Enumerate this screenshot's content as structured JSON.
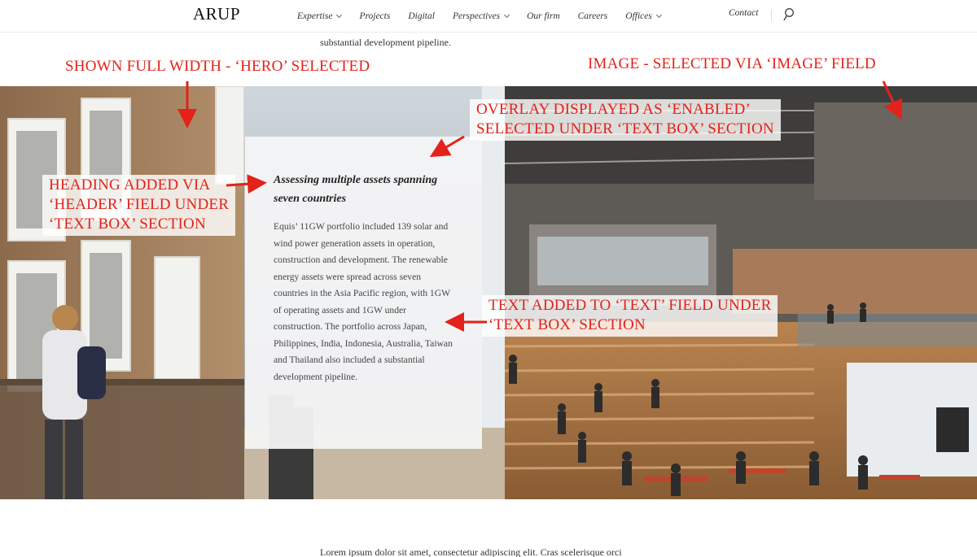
{
  "brand": {
    "logo_text": "ARUP"
  },
  "nav": {
    "items": [
      {
        "label": "Expertise",
        "has_dropdown": true
      },
      {
        "label": "Projects",
        "has_dropdown": false
      },
      {
        "label": "Digital",
        "has_dropdown": false
      },
      {
        "label": "Perspectives",
        "has_dropdown": true
      },
      {
        "label": "Our firm",
        "has_dropdown": false
      },
      {
        "label": "Careers",
        "has_dropdown": false
      },
      {
        "label": "Offices",
        "has_dropdown": true
      }
    ],
    "contact_label": "Contact",
    "search_icon": "search-icon"
  },
  "page": {
    "intro_line": "substantial development pipeline.",
    "lorem_line": "Lorem ipsum dolor sit amet, consectetur adipiscing elit. Cras scelerisque orci"
  },
  "hero": {
    "overlay_enabled": true,
    "heading": "Assessing multiple assets spanning seven countries",
    "text": "Equis’ 11GW portfolio included 139 solar and wind power generation assets in operation, construction and development. The renewable energy assets were spread across seven countries in the Asia Pacific region, with 1GW of operating assets and 1GW under construction. The portfolio across Japan, Philippines, India, Indonesia, Australia, Taiwan and Thailand also included a substantial development pipeline."
  },
  "annotations": {
    "a1": "SHOWN FULL WIDTH - ‘HERO’ SELECTED",
    "a2": "IMAGE - SELECTED VIA ‘IMAGE’ FIELD",
    "a3_line1": "OVERLAY DISPLAYED AS ‘ENABLED’",
    "a3_line2": "SELECTED UNDER ‘TEXT BOX’ SECTION",
    "a4_line1": "HEADING ADDED VIA",
    "a4_line2": "‘HEADER’ FIELD UNDER",
    "a4_line3": "‘TEXT BOX’ SECTION",
    "a5_line1": "TEXT ADDED TO ‘TEXT’ FIELD UNDER",
    "a5_line2": "‘TEXT BOX’ SECTION"
  },
  "colors": {
    "annotation": "#e32219",
    "overlay_bg": "#f4f4f6",
    "nav_text": "#333333"
  }
}
